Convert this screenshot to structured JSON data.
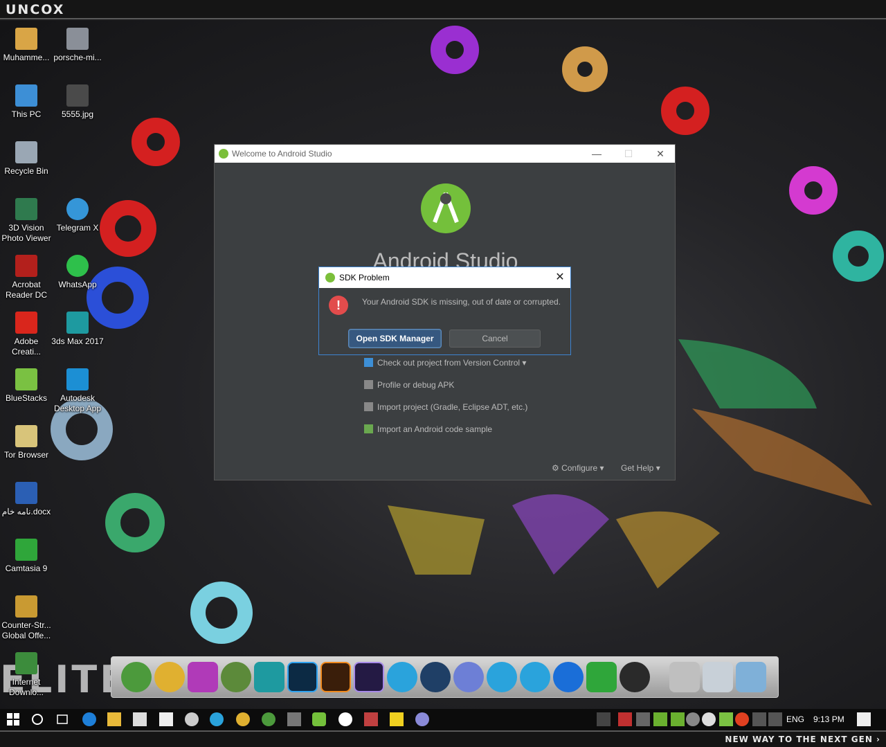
{
  "topbar": {
    "logo": "UNCOX"
  },
  "bottombar": {
    "tagline": "NEW WAY TO THE NEXT GEN ›"
  },
  "desktop_icons": [
    {
      "label": "Muhamme...",
      "color": "#d9a546"
    },
    {
      "label": "porsche-mi...",
      "color": "#8a8f98"
    },
    {
      "label": "This PC",
      "color": "#3d8fd6"
    },
    {
      "label": "5555.jpg",
      "color": "#4a4a4a"
    },
    {
      "label": "Recycle Bin",
      "color": "#9aa7b4"
    },
    {
      "label": "3D Vision Photo Viewer",
      "color": "#2f7a4e"
    },
    {
      "label": "Telegram X",
      "color": "#3596d8"
    },
    {
      "label": "Acrobat Reader DC",
      "color": "#b3201c"
    },
    {
      "label": "WhatsApp",
      "color": "#2ec04b"
    },
    {
      "label": "Adobe Creati...",
      "color": "#d9261c"
    },
    {
      "label": "3ds Max 2017",
      "color": "#1e9aa0"
    },
    {
      "label": "BlueStacks",
      "color": "#7ac142"
    },
    {
      "label": "Autodesk Desktop App",
      "color": "#1c8fd4"
    },
    {
      "label": "Tor Browser",
      "color": "#d8c47a"
    },
    {
      "label": "نامه خام.docx",
      "color": "#2b5fb4"
    },
    {
      "label": "Camtasia 9",
      "color": "#2fa63a"
    },
    {
      "label": "Counter-Str... Global Offe...",
      "color": "#c99a32"
    },
    {
      "label": "Internet Downlo...",
      "color": "#3c8c3c"
    }
  ],
  "android_studio": {
    "title": "Welcome to Android Studio",
    "app_name": "Android Studio",
    "actions": [
      "Check out project from Version Control ▾",
      "Profile or debug APK",
      "Import project (Gradle, Eclipse ADT, etc.)",
      "Import an Android code sample"
    ],
    "configure": "⚙ Configure ▾",
    "get_help": "Get Help ▾",
    "accent": "#74c03b"
  },
  "sdk_dialog": {
    "title": "SDK Problem",
    "message": "Your Android SDK is missing, out of date or corrupted.",
    "primary_button": "Open SDK Manager",
    "cancel_button": "Cancel",
    "error_glyph": "!"
  },
  "dock": {
    "elite_text": "ELITE",
    "apps": [
      {
        "name": "Earth",
        "color": "#4c9a3c"
      },
      {
        "name": "Chrome",
        "color": "#e0b030"
      },
      {
        "name": "PhpStorm",
        "color": "#b03ab8"
      },
      {
        "name": "Android Studio",
        "color": "#5c8a3a"
      },
      {
        "name": "3ds Max",
        "color": "#1e9aa0"
      },
      {
        "name": "Photoshop",
        "color": "#0c2a44"
      },
      {
        "name": "Illustrator",
        "color": "#3a1e0a"
      },
      {
        "name": "After Effects",
        "color": "#241a44"
      },
      {
        "name": "Telegram",
        "color": "#2aa3dc"
      },
      {
        "name": "Steam",
        "color": "#1f3f66"
      },
      {
        "name": "Discord",
        "color": "#6d7fd6"
      },
      {
        "name": "Telegram 2",
        "color": "#2aa3dc"
      },
      {
        "name": "Telegram 3",
        "color": "#2aa3dc"
      },
      {
        "name": "TeamViewer",
        "color": "#1a6ed8"
      },
      {
        "name": "Camtasia",
        "color": "#2fa63a"
      },
      {
        "name": "Lantern",
        "color": "#2a2a2a"
      },
      {
        "name": "Monitor",
        "color": "#bfbfbf"
      },
      {
        "name": "Trash",
        "color": "#c8d0d8"
      },
      {
        "name": "Music Folder",
        "color": "#7fb0d8"
      }
    ]
  },
  "taskbar": {
    "lang": "ENG",
    "time": "9:13 PM"
  }
}
